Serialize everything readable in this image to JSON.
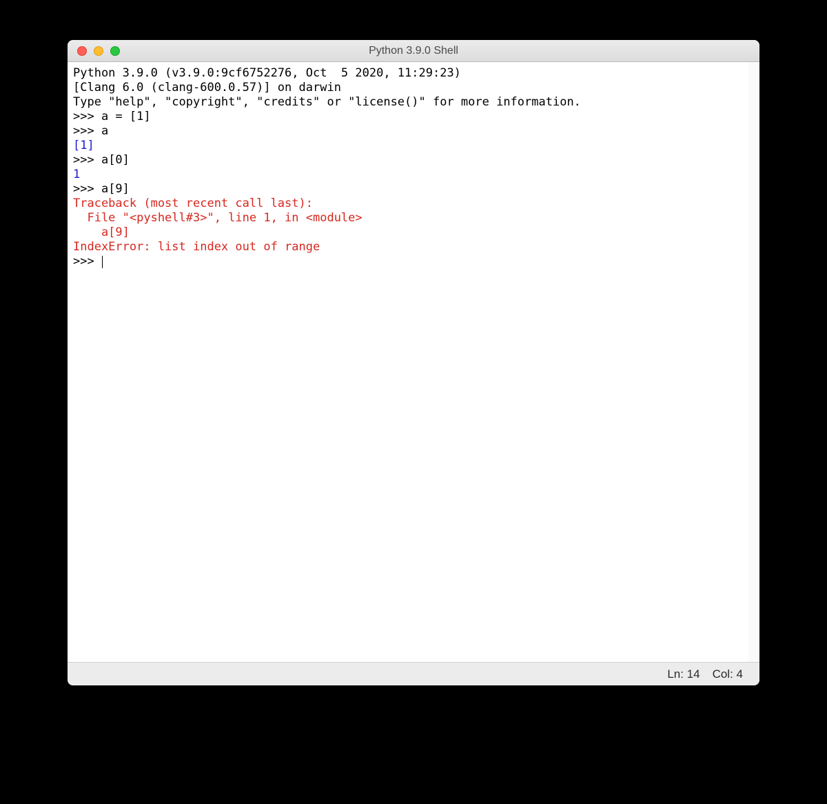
{
  "titlebar": {
    "title": "Python 3.9.0 Shell"
  },
  "console": {
    "banner1": "Python 3.9.0 (v3.9.0:9cf6752276, Oct  5 2020, 11:29:23) ",
    "banner2": "[Clang 6.0 (clang-600.0.57)] on darwin",
    "banner3": "Type \"help\", \"copyright\", \"credits\" or \"license()\" for more information.",
    "prompt": ">>> ",
    "line1_code": "a = [1]",
    "line2_code": "a",
    "out1": "[1]",
    "line3_code": "a[0]",
    "out2": "1",
    "line4_code": "a[9]",
    "err1": "Traceback (most recent call last):",
    "err2": "  File \"<pyshell#3>\", line 1, in <module>",
    "err3": "    a[9]",
    "err4": "IndexError: list index out of range"
  },
  "statusbar": {
    "ln": "Ln: 14",
    "col": "Col: 4"
  }
}
